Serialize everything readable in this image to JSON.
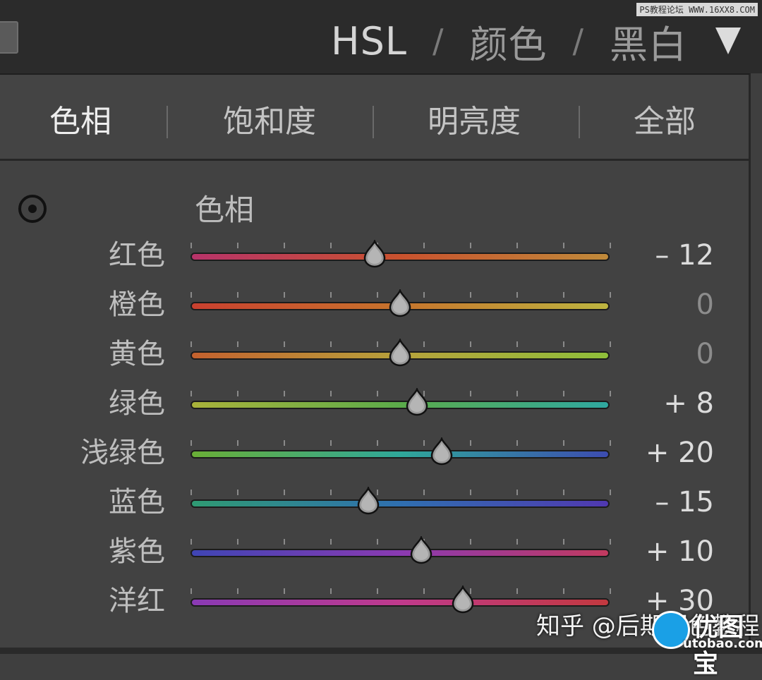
{
  "header": {
    "tabs": [
      "HSL",
      "颜色",
      "黑白"
    ],
    "separator": "/",
    "watermark": "PS教程论坛 WWW.16XX8.COM"
  },
  "subtabs": [
    "色相",
    "饱和度",
    "明亮度",
    "全部"
  ],
  "section": {
    "title": "色相"
  },
  "sliders": [
    {
      "label": "红色",
      "value": "– 12",
      "level": -12,
      "colors": [
        "#b8336a",
        "#c9522e",
        "#c08a3a"
      ]
    },
    {
      "label": "橙色",
      "value": "0",
      "level": 0,
      "colors": [
        "#c9402f",
        "#c7742c",
        "#bdb540"
      ]
    },
    {
      "label": "黄色",
      "value": "0",
      "level": 0,
      "colors": [
        "#c4612e",
        "#b7a23b",
        "#8fbf3a"
      ]
    },
    {
      "label": "绿色",
      "value": "+ 8",
      "level": 8,
      "colors": [
        "#a9b23a",
        "#5bab4a",
        "#2fa8a0"
      ]
    },
    {
      "label": "浅绿色",
      "value": "+ 20",
      "level": 20,
      "colors": [
        "#6aaf36",
        "#2fa89a",
        "#3c4cb0"
      ]
    },
    {
      "label": "蓝色",
      "value": "– 15",
      "level": -15,
      "colors": [
        "#2f9b73",
        "#2f6fb0",
        "#5038b0"
      ]
    },
    {
      "label": "紫色",
      "value": "+ 10",
      "level": 10,
      "colors": [
        "#3f45b4",
        "#8a3ab2",
        "#c23a5f"
      ]
    },
    {
      "label": "洋红",
      "value": "+ 30",
      "level": 30,
      "colors": [
        "#8a3ab4",
        "#c03a8c",
        "#c2393f"
      ]
    }
  ],
  "watermark_bottom": "知乎 @后期调色教程",
  "logo": {
    "text": "优图宝",
    "sub": "utobao.com"
  }
}
